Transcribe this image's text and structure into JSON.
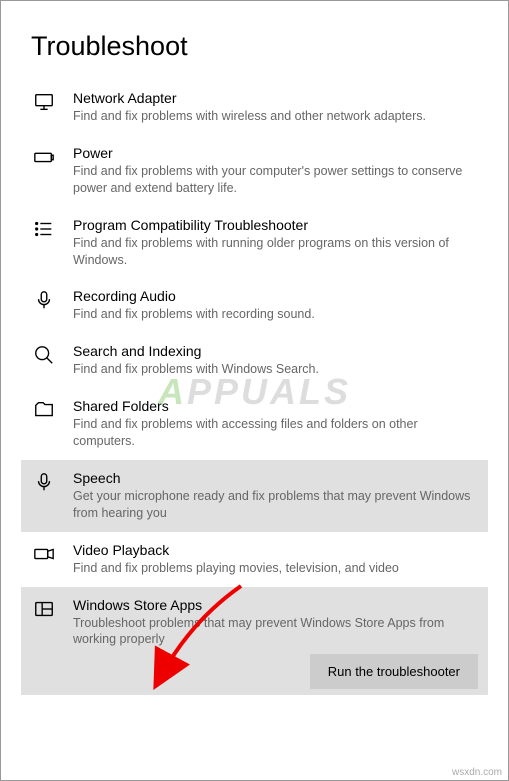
{
  "page_title": "Troubleshoot",
  "items": [
    {
      "title": "Network Adapter",
      "desc": "Find and fix problems with wireless and other network adapters.",
      "selected": false
    },
    {
      "title": "Power",
      "desc": "Find and fix problems with your computer's power settings to conserve power and extend battery life.",
      "selected": false
    },
    {
      "title": "Program Compatibility Troubleshooter",
      "desc": "Find and fix problems with running older programs on this version of Windows.",
      "selected": false
    },
    {
      "title": "Recording Audio",
      "desc": "Find and fix problems with recording sound.",
      "selected": false
    },
    {
      "title": "Search and Indexing",
      "desc": "Find and fix problems with Windows Search.",
      "selected": false
    },
    {
      "title": "Shared Folders",
      "desc": "Find and fix problems with accessing files and folders on other computers.",
      "selected": false
    },
    {
      "title": "Speech",
      "desc": "Get your microphone ready and fix problems that may prevent Windows from hearing you",
      "selected": true
    },
    {
      "title": "Video Playback",
      "desc": "Find and fix problems playing movies, television, and video",
      "selected": false
    },
    {
      "title": "Windows Store Apps",
      "desc": "Troubleshoot problems that may prevent Windows Store Apps from working properly",
      "selected": true,
      "show_button": true
    }
  ],
  "run_button_label": "Run the troubleshooter",
  "watermark": "APPUALS",
  "footer_credit": "wsxdn.com"
}
